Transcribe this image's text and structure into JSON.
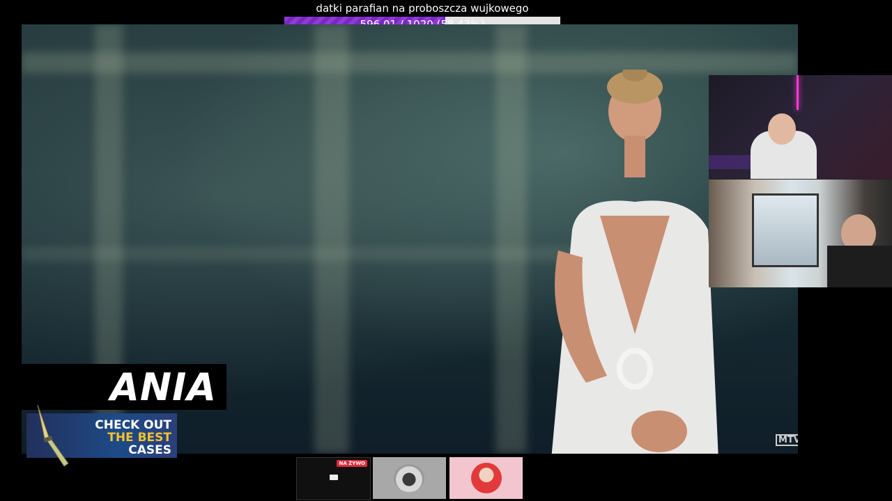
{
  "goal": {
    "title": "datki parafian na proboszcza wujkowego",
    "progress_text": "596.01 / 1020 (58.43%)",
    "progress_fraction": 0.5843,
    "fill_color": "#8f3bd6"
  },
  "lower_third": {
    "name": "ANIA"
  },
  "promo": {
    "line1": "CHECK OUT",
    "line2": "THE BEST",
    "line3": "CASES",
    "accent_color": "#f4c22b"
  },
  "watermark": {
    "text": "MTV"
  },
  "thumbnails": {
    "live_badge": "NA ŻYWO"
  },
  "icons": {
    "knife": "knife-icon",
    "channel_logo": "channel-logo-icon",
    "car": "car-icon",
    "monitor": "monitor-icon"
  }
}
